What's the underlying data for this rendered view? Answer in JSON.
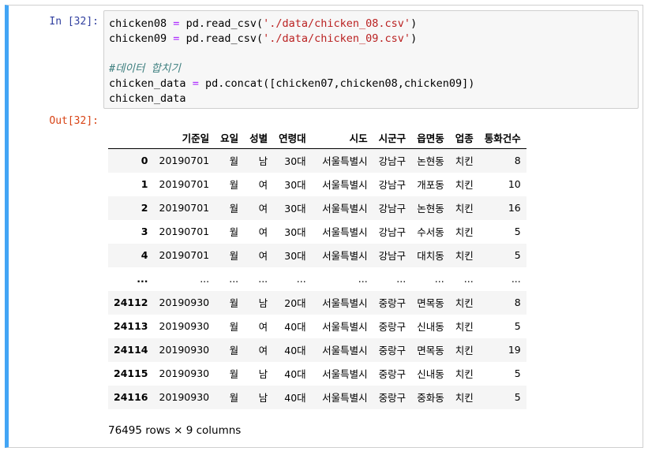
{
  "input_prompt": "In [32]:",
  "output_prompt": "Out[32]:",
  "code": {
    "line1": {
      "var": "chicken08",
      "op": "=",
      "call": "pd.read_csv(",
      "str": "'./data/chicken_08.csv'",
      "end": ")"
    },
    "line2": {
      "var": "chicken09",
      "op": "=",
      "call": "pd.read_csv(",
      "str": "'./data/chicken_09.csv'",
      "end": ")"
    },
    "comment": "#데이터 합치기",
    "line4": {
      "var": "chicken_data",
      "op": "=",
      "rest": "pd.concat([chicken07,chicken08,chicken09])"
    },
    "line5": "chicken_data"
  },
  "table": {
    "columns": [
      "기준일",
      "요일",
      "성별",
      "연령대",
      "시도",
      "시군구",
      "읍면동",
      "업종",
      "통화건수"
    ],
    "rows": [
      {
        "index": "0",
        "cells": [
          "20190701",
          "월",
          "남",
          "30대",
          "서울특별시",
          "강남구",
          "논현동",
          "치킨",
          "8"
        ]
      },
      {
        "index": "1",
        "cells": [
          "20190701",
          "월",
          "여",
          "30대",
          "서울특별시",
          "강남구",
          "개포동",
          "치킨",
          "10"
        ]
      },
      {
        "index": "2",
        "cells": [
          "20190701",
          "월",
          "여",
          "30대",
          "서울특별시",
          "강남구",
          "논현동",
          "치킨",
          "16"
        ]
      },
      {
        "index": "3",
        "cells": [
          "20190701",
          "월",
          "여",
          "30대",
          "서울특별시",
          "강남구",
          "수서동",
          "치킨",
          "5"
        ]
      },
      {
        "index": "4",
        "cells": [
          "20190701",
          "월",
          "여",
          "30대",
          "서울특별시",
          "강남구",
          "대치동",
          "치킨",
          "5"
        ]
      },
      {
        "index": "...",
        "cells": [
          "...",
          "...",
          "...",
          "...",
          "...",
          "...",
          "...",
          "...",
          "..."
        ]
      },
      {
        "index": "24112",
        "cells": [
          "20190930",
          "월",
          "남",
          "20대",
          "서울특별시",
          "중랑구",
          "면목동",
          "치킨",
          "8"
        ]
      },
      {
        "index": "24113",
        "cells": [
          "20190930",
          "월",
          "여",
          "40대",
          "서울특별시",
          "중랑구",
          "신내동",
          "치킨",
          "5"
        ]
      },
      {
        "index": "24114",
        "cells": [
          "20190930",
          "월",
          "여",
          "40대",
          "서울특별시",
          "중랑구",
          "면목동",
          "치킨",
          "19"
        ]
      },
      {
        "index": "24115",
        "cells": [
          "20190930",
          "월",
          "남",
          "40대",
          "서울특별시",
          "중랑구",
          "신내동",
          "치킨",
          "5"
        ]
      },
      {
        "index": "24116",
        "cells": [
          "20190930",
          "월",
          "남",
          "40대",
          "서울특별시",
          "중랑구",
          "중화동",
          "치킨",
          "5"
        ]
      }
    ]
  },
  "summary": "76495 rows × 9 columns"
}
